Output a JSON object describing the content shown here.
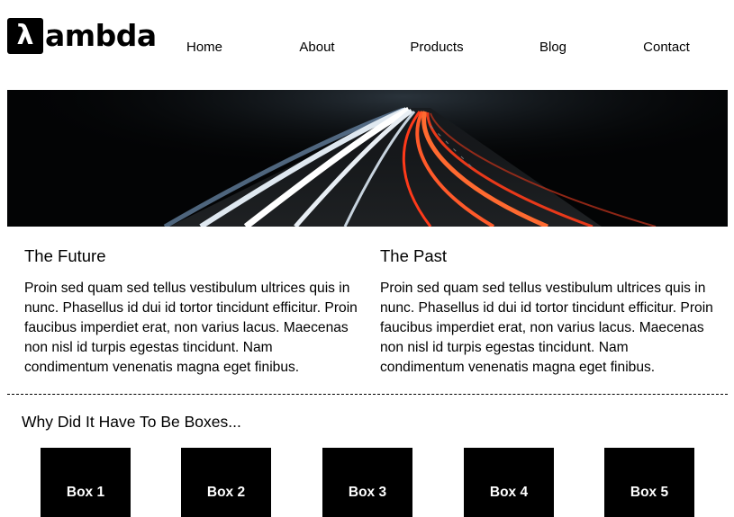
{
  "logo": {
    "mark": "λ",
    "text": "ambda"
  },
  "nav": {
    "items": [
      "Home",
      "About",
      "Products",
      "Blog",
      "Contact"
    ]
  },
  "hero": {
    "image": "highway light trails at night"
  },
  "columns": [
    {
      "heading": "The Future",
      "body": "Proin sed quam sed tellus vestibulum ultrices quis in nunc. Phasellus id dui id tortor tincidunt efficitur. Proin faucibus imperdiet erat, non varius lacus. Maecenas non nisl id turpis egestas tincidunt. Nam condimentum venenatis magna eget finibus."
    },
    {
      "heading": "The Past",
      "body": "Proin sed quam sed tellus vestibulum ultrices quis in nunc. Phasellus id dui id tortor tincidunt efficitur. Proin faucibus imperdiet erat, non varius lacus. Maecenas non nisl id turpis egestas tincidunt. Nam condimentum venenatis magna eget finibus."
    }
  ],
  "boxes": {
    "title": "Why Did It Have To Be Boxes...",
    "items": [
      "Box 1",
      "Box 2",
      "Box 3",
      "Box 4",
      "Box 5"
    ]
  },
  "colors": {
    "background": "#ffffff",
    "text": "#000000",
    "box": "#000000",
    "box_text": "#ffffff"
  }
}
